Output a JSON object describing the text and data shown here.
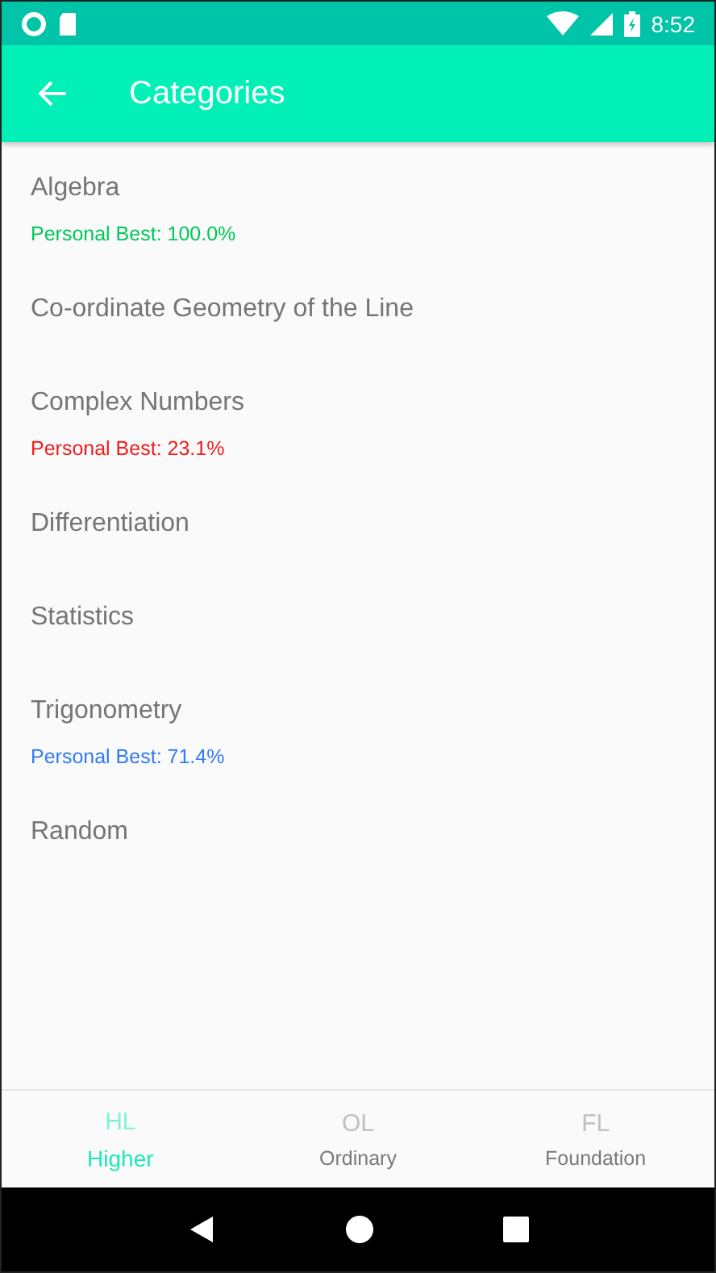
{
  "status_bar": {
    "time": "8:52"
  },
  "app_bar": {
    "title": "Categories"
  },
  "categories": [
    {
      "name": "Algebra",
      "personal_best": "Personal Best: 100.0%",
      "color": "#00c85a"
    },
    {
      "name": "Co-ordinate Geometry of the Line"
    },
    {
      "name": "Complex Numbers",
      "personal_best": "Personal Best: 23.1%",
      "color": "#f01c1c"
    },
    {
      "name": "Differentiation"
    },
    {
      "name": "Statistics"
    },
    {
      "name": "Trigonometry",
      "personal_best": "Personal Best: 71.4%",
      "color": "#2f7bf5"
    },
    {
      "name": "Random"
    }
  ],
  "bottom_nav": [
    {
      "code": "HL",
      "label": "Higher",
      "selected": true
    },
    {
      "code": "OL",
      "label": "Ordinary",
      "selected": false
    },
    {
      "code": "FL",
      "label": "Foundation",
      "selected": false
    }
  ]
}
